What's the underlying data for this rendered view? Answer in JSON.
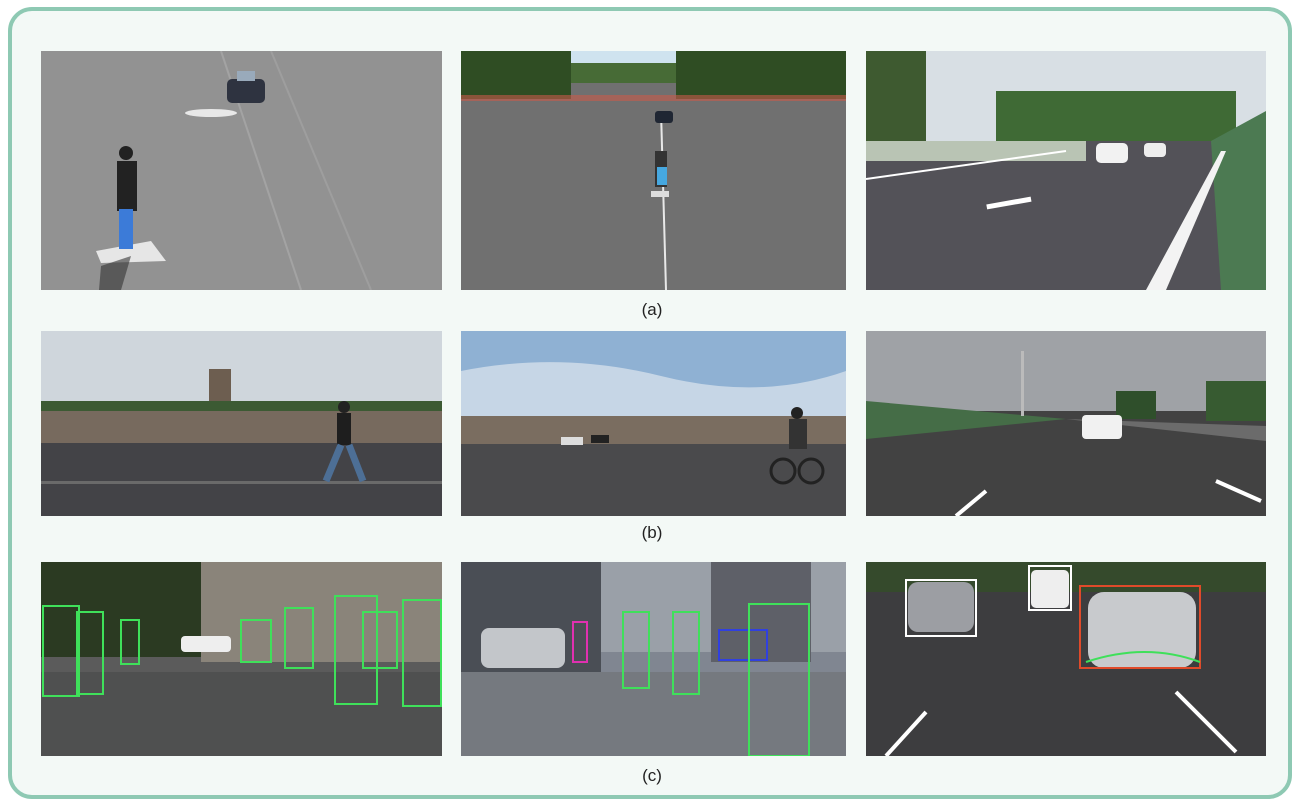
{
  "figure": {
    "rows": [
      {
        "caption": "(a)",
        "panels": [
          {
            "name": "pedestrian-dummy-on-test-track-with-car"
          },
          {
            "name": "cyclist-dummy-on-test-track"
          },
          {
            "name": "highway-with-cars"
          }
        ]
      },
      {
        "caption": "(b)",
        "panels": [
          {
            "name": "pedestrian-crossing-test-track"
          },
          {
            "name": "cyclist-on-test-track"
          },
          {
            "name": "highway-with-car-ahead"
          }
        ]
      },
      {
        "caption": "(c)",
        "panels": [
          {
            "name": "pedestrian-detection-street"
          },
          {
            "name": "cyclist-detection-street"
          },
          {
            "name": "vehicle-detection-highway"
          }
        ]
      }
    ]
  },
  "colors": {
    "frame_border": "#8ec9b3",
    "frame_fill": "#f3f9f6",
    "detection_box_green": "#3fe05a",
    "detection_box_red": "#e04a2a",
    "detection_box_white": "#ffffff"
  }
}
